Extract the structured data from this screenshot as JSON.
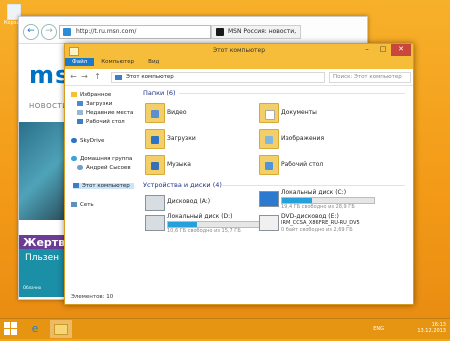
{
  "desktop": {
    "recycle_label": "Корзина"
  },
  "browser": {
    "address": "http://t.ru.msn.com/",
    "tab_title": "MSN Россия: новости, эле...",
    "logo": "msn",
    "nav_label": "НОВОСТИ",
    "hero_text": "Жертвы",
    "promo_title": "Пльзен",
    "promo_sub": "Облачно"
  },
  "explorer": {
    "title": "Этот компьютер",
    "ribbon_tabs": [
      "Файл",
      "Компьютер",
      "Вид"
    ],
    "breadcrumb": "Этот компьютер",
    "search_placeholder": "Поиск: Этот компьютер",
    "sidebar": {
      "favorites": "Избранное",
      "favorites_items": [
        "Загрузки",
        "Недавние места",
        "Рабочий стол"
      ],
      "skydrive": "SkyDrive",
      "homegroup": "Домашняя группа",
      "homegroup_user": "Андрей Сысоев",
      "this_pc": "Этот компьютер",
      "network": "Сеть"
    },
    "folders_header": "Папки (6)",
    "folders": [
      "Видео",
      "Документы",
      "Загрузки",
      "Изображения",
      "Музыка",
      "Рабочий стол"
    ],
    "devices_header": "Устройства и диски (4)",
    "drives": [
      {
        "name": "Дисковод (A:)",
        "free": "",
        "fill": null
      },
      {
        "name": "Локальный диск (C:)",
        "free": "19,4 ГБ свободно из 28,9 ГБ",
        "fill": 0.33
      },
      {
        "name": "Локальный диск (D:)",
        "free": "10,6 ГБ свободно из 15,7 ГБ",
        "fill": 0.32
      },
      {
        "name": "DVD-дисковод (E:)",
        "label": "IRM_CCSA_X86FRE_RU-RU_DV5",
        "free": "0 байт свободно из 2,69 ГБ",
        "fill": null
      }
    ],
    "status": "Элементов: 10"
  },
  "taskbar": {
    "lang": "ENG",
    "time": "16:13",
    "date": "13.12.2013"
  },
  "colors": {
    "desktop": "#f39a17",
    "explorer_frame": "#f5bd3a",
    "ribbon_active": "#1979ca",
    "drive_bar": "#26a0da"
  }
}
